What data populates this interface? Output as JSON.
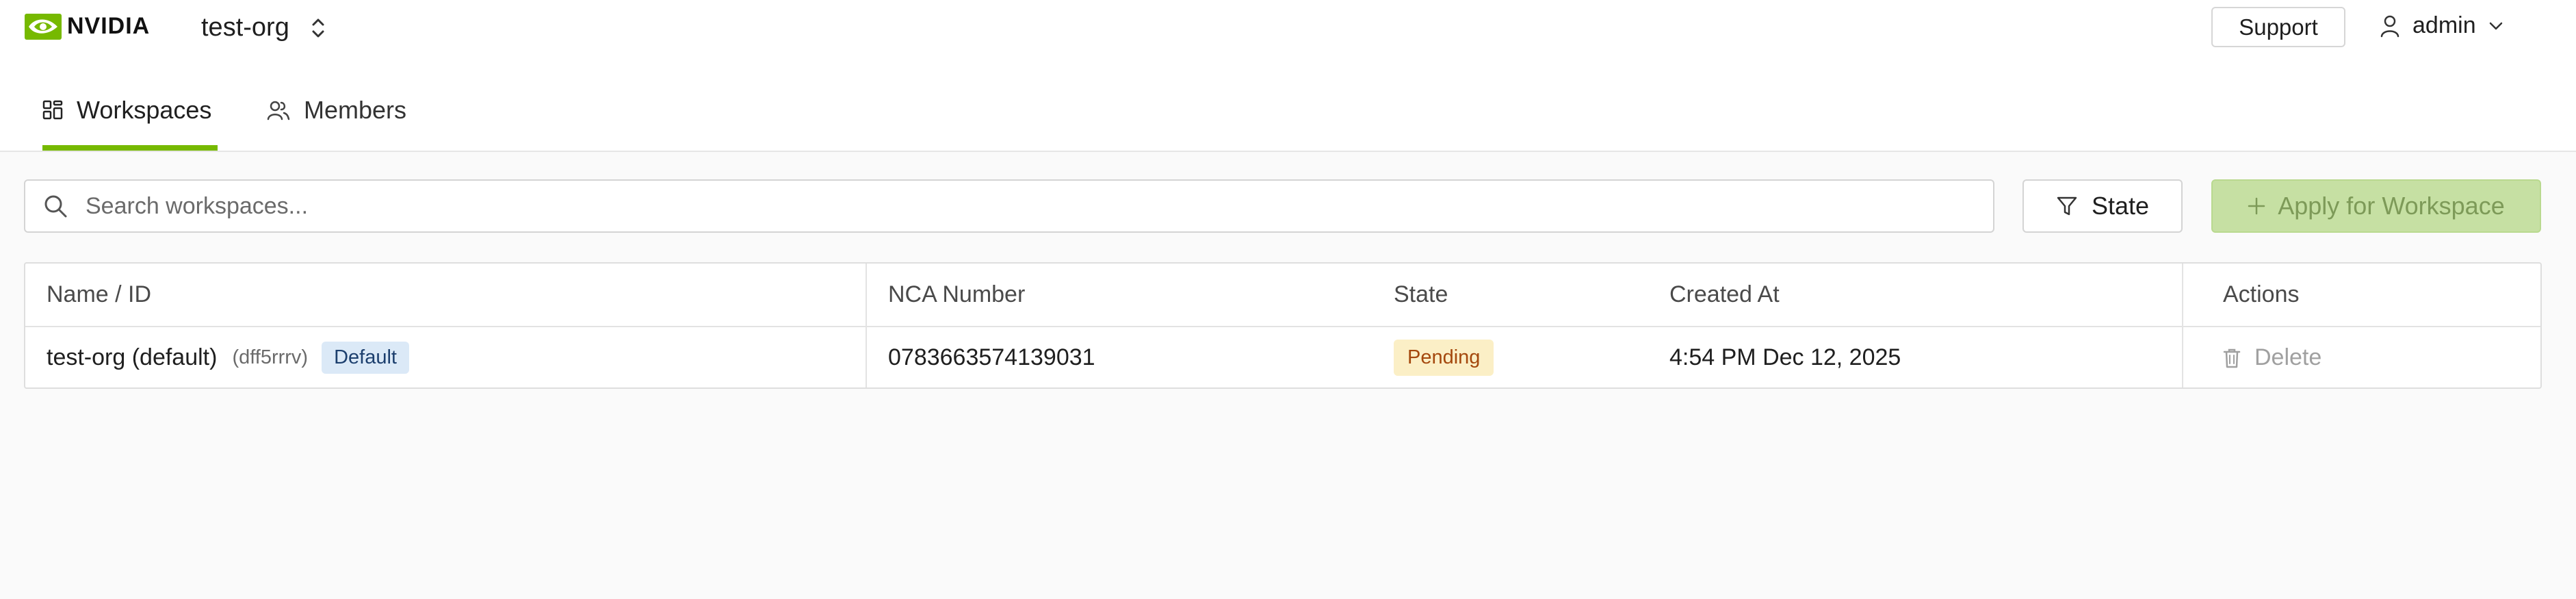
{
  "header": {
    "brand": "NVIDIA",
    "org_name": "test-org",
    "support_label": "Support",
    "user_name": "admin"
  },
  "tabs": [
    {
      "label": "Workspaces",
      "icon": "grid-icon",
      "active": true
    },
    {
      "label": "Members",
      "icon": "users-icon",
      "active": false
    }
  ],
  "toolbar": {
    "search_placeholder": "Search workspaces...",
    "state_label": "State",
    "apply_label": "Apply for Workspace"
  },
  "table": {
    "columns": [
      "Name / ID",
      "NCA Number",
      "State",
      "Created At",
      "Actions"
    ],
    "rows": [
      {
        "name": "test-org (default)",
        "id": "(dff5rrrv)",
        "badge": "Default",
        "nca_number": "0783663574139031",
        "state": "Pending",
        "created_at": "4:54 PM Dec 12, 2025",
        "action": "Delete"
      }
    ]
  },
  "colors": {
    "accent": "#76b900",
    "apply_bg": "#c6e0a3",
    "pending_bg": "#fbefc6",
    "default_badge_bg": "#dbe9f7"
  }
}
